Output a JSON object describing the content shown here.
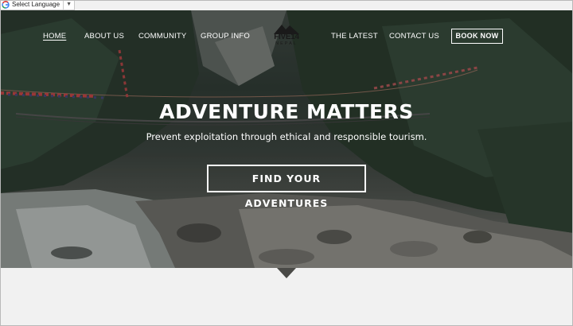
{
  "translate": {
    "label": "Select Language",
    "arrow": "▼"
  },
  "nav": {
    "items": [
      {
        "label": "HOME"
      },
      {
        "label": "ABOUT US"
      },
      {
        "label": "COMMUNITY"
      },
      {
        "label": "GROUP INFO"
      },
      {
        "label": "THE LATEST"
      },
      {
        "label": "CONTACT US"
      }
    ],
    "book_label": "BOOK NOW"
  },
  "logo": {
    "text": "FIVE14",
    "subtext": "NEPAL"
  },
  "hero": {
    "title": "ADVENTURE MATTERS",
    "subtitle": "Prevent exploitation through ethical and responsible tourism.",
    "cta_label": "FIND YOUR ADVENTURES"
  }
}
